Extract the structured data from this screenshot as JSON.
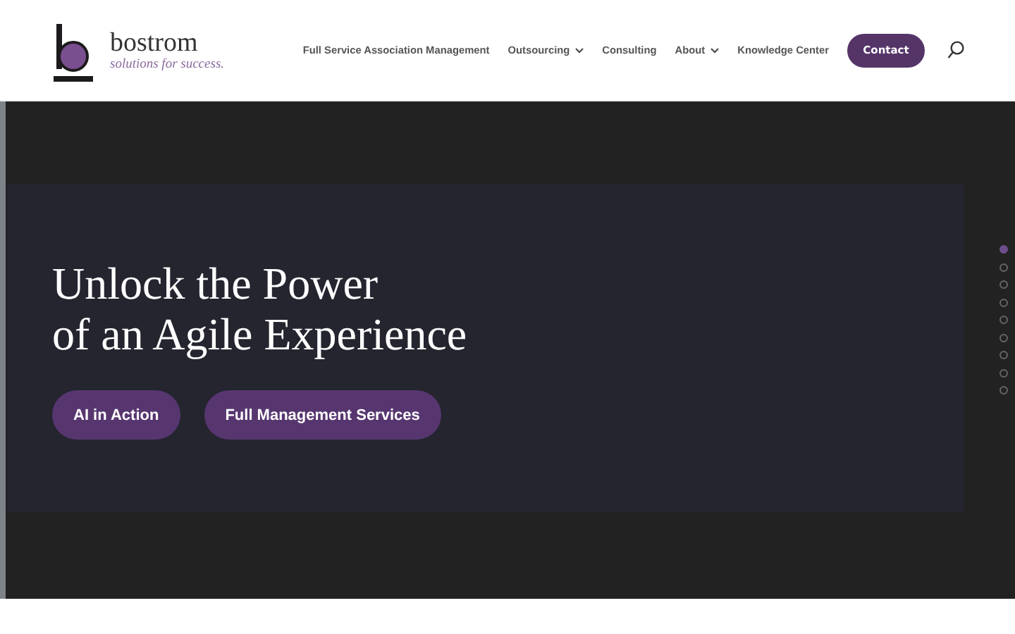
{
  "logo": {
    "name": "bostrom",
    "tagline": "solutions for success."
  },
  "nav": [
    {
      "label": "Full Service Association Management",
      "dropdown": false
    },
    {
      "label": "Outsourcing",
      "dropdown": true
    },
    {
      "label": "Consulting",
      "dropdown": false
    },
    {
      "label": "About",
      "dropdown": true
    },
    {
      "label": "Knowledge Center",
      "dropdown": false
    }
  ],
  "contact_button": "Contact",
  "hero": {
    "title_lines": [
      "Unlock the Power",
      "of an Agile Experience"
    ],
    "buttons": [
      "AI in Action",
      "Full Management Services"
    ]
  },
  "slide_dots": [
    {
      "selected": true
    },
    {
      "selected": false
    },
    {
      "selected": false
    },
    {
      "selected": false
    },
    {
      "selected": false
    },
    {
      "selected": false
    },
    {
      "selected": false
    },
    {
      "selected": false
    },
    {
      "selected": false
    }
  ]
}
